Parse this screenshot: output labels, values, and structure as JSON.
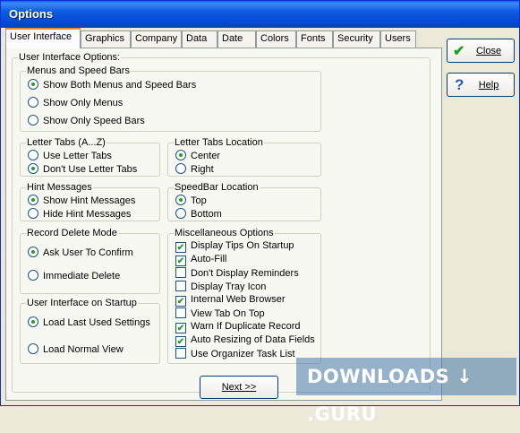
{
  "window": {
    "title": "Options"
  },
  "tabs": [
    "User Interface",
    "Graphics",
    "Company",
    "Data",
    "Date",
    "Colors",
    "Fonts",
    "Security",
    "Users"
  ],
  "panel_title": "User Interface Options:",
  "menus": {
    "title": "Menus and Speed Bars",
    "options": [
      "Show Both Menus and Speed Bars",
      "Show Only Menus",
      "Show Only Speed Bars"
    ],
    "selected": 0
  },
  "letter_tabs": {
    "title": "Letter Tabs (A...Z)",
    "options": [
      "Use Letter Tabs",
      "Don't Use Letter Tabs"
    ],
    "selected": 1
  },
  "letter_tabs_location": {
    "title": "Letter Tabs Location",
    "options": [
      "Center",
      "Right"
    ],
    "selected": 0
  },
  "hint": {
    "title": "Hint Messages",
    "options": [
      "Show Hint Messages",
      "Hide Hint Messages"
    ],
    "selected": 0
  },
  "speedbar_location": {
    "title": "SpeedBar Location",
    "options": [
      "Top",
      "Bottom"
    ],
    "selected": 0
  },
  "record_delete": {
    "title": "Record Delete Mode",
    "options": [
      "Ask User To Confirm",
      "Immediate Delete"
    ],
    "selected": 0
  },
  "startup": {
    "title": "User Interface on Startup",
    "options": [
      "Load Last Used Settings",
      "Load Normal View"
    ],
    "selected": 0
  },
  "misc": {
    "title": "Miscellaneous Options",
    "options": [
      {
        "label": "Display Tips On Startup",
        "checked": true
      },
      {
        "label": "Auto-Fill",
        "checked": true
      },
      {
        "label": "Don't Display Reminders",
        "checked": false
      },
      {
        "label": "Display Tray Icon",
        "checked": false
      },
      {
        "label": "Internal Web Browser",
        "checked": true
      },
      {
        "label": "View Tab On Top",
        "checked": false
      },
      {
        "label": "Warn If Duplicate Record",
        "checked": true
      },
      {
        "label": "Auto Resizing of Data Fields",
        "checked": true
      },
      {
        "label": "Use Organizer Task List",
        "checked": false
      }
    ]
  },
  "buttons": {
    "close": "Close",
    "help": "Help",
    "next": "Next >>"
  },
  "watermark": "DOWNLOADS ↓ .GURU",
  "colors": {
    "check": "#21A121",
    "title_bar": "#0A5FE8"
  }
}
